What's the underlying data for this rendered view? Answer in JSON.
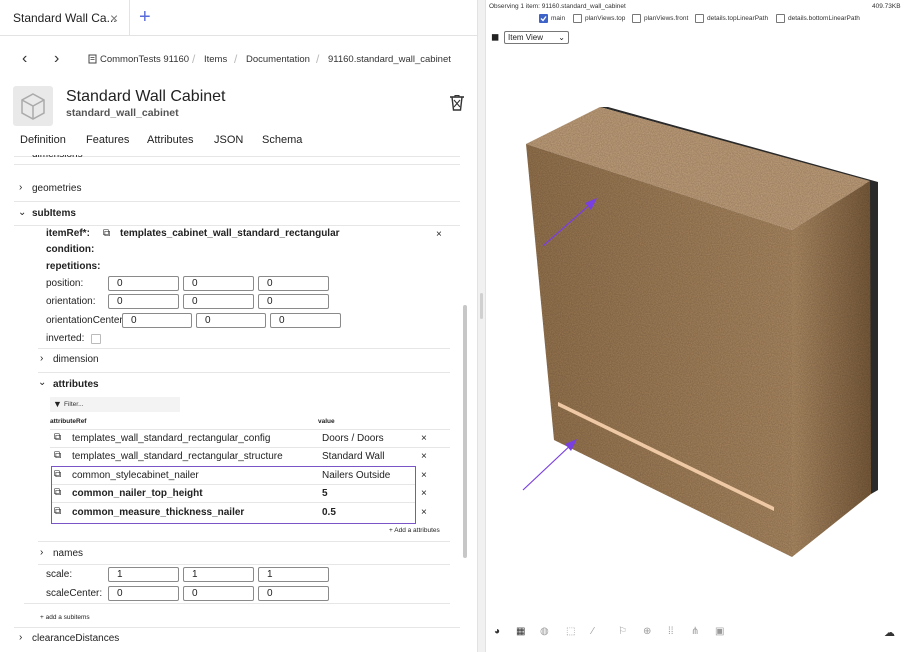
{
  "tab": {
    "title": "Standard Wall Ca...",
    "close": "×",
    "add": "+"
  },
  "nav": {
    "back": "‹",
    "forward": "›",
    "breadcrumb": [
      "CommonTests 91160",
      "Items",
      "Documentation",
      "91160.standard_wall_cabinet"
    ],
    "sep": "/"
  },
  "item": {
    "title": "Standard Wall Cabinet",
    "subtitle": "standard_wall_cabinet"
  },
  "section_tabs": [
    "Definition",
    "Features",
    "Attributes",
    "JSON",
    "Schema"
  ],
  "tree": {
    "dimensions": "dimensions",
    "geometries": "geometries",
    "subitems": "subItems",
    "itemref_label": "itemRef*:",
    "itemref_value": "templates_cabinet_wall_standard_rectangular",
    "condition": "condition:",
    "repetitions": "repetitions:",
    "position": {
      "label": "position:",
      "values": [
        "0",
        "0",
        "0"
      ]
    },
    "orientation": {
      "label": "orientation:",
      "values": [
        "0",
        "0",
        "0"
      ]
    },
    "orientation_center": {
      "label": "orientationCenter:",
      "values": [
        "0",
        "0",
        "0"
      ]
    },
    "inverted": "inverted:",
    "dimension": "dimension",
    "attributes": "attributes",
    "filter_placeholder": "Filter...",
    "col_ref": "attributeRef",
    "col_value": "value",
    "attr_rows": [
      {
        "ref": "templates_wall_standard_rectangular_config",
        "value": "Doors / Doors",
        "bold": false
      },
      {
        "ref": "templates_wall_standard_rectangular_structure",
        "value": "Standard Wall",
        "bold": false
      },
      {
        "ref": "common_stylecabinet_nailer",
        "value": "Nailers Outside",
        "bold": false
      },
      {
        "ref": "common_nailer_top_height",
        "value": "5",
        "bold": true
      },
      {
        "ref": "common_measure_thickness_nailer",
        "value": "0.5",
        "bold": true
      }
    ],
    "remove": "×",
    "add_attributes": "+ Add a attributes",
    "names": "names",
    "scale": {
      "label": "scale:",
      "values": [
        "1",
        "1",
        "1"
      ]
    },
    "scale_center": {
      "label": "scaleCenter:",
      "values": [
        "0",
        "0",
        "0"
      ]
    },
    "add_subitems": "+ add a subitems",
    "clearance": "clearanceDistances"
  },
  "viewer": {
    "observing": "Observing 1 item: 91160.standard_wall_cabinet",
    "size": "409.73KB",
    "checkboxes": [
      {
        "label": "main",
        "checked": true
      },
      {
        "label": "planViews.top",
        "checked": false
      },
      {
        "label": "planViews.front",
        "checked": false
      },
      {
        "label": "details.topLinearPath",
        "checked": false
      },
      {
        "label": "details.bottomLinearPath",
        "checked": false
      }
    ],
    "view_select": "Item View",
    "colors": {
      "cabinet_front": "#a8845c",
      "cabinet_top": "#c7a47e",
      "cabinet_side": "#8c6a45",
      "back_panel": "#2a2a2a",
      "nailer": "#efc9a6",
      "arrow": "#7a3fe0"
    }
  },
  "bottom_icons": [
    "palette-icon",
    "grid-icon",
    "sphere-icon",
    "cube-icon",
    "brush-icon",
    "flag-icon",
    "target-icon",
    "dots-grid-icon",
    "network-icon",
    "image-icon",
    "cloud-download-icon"
  ]
}
